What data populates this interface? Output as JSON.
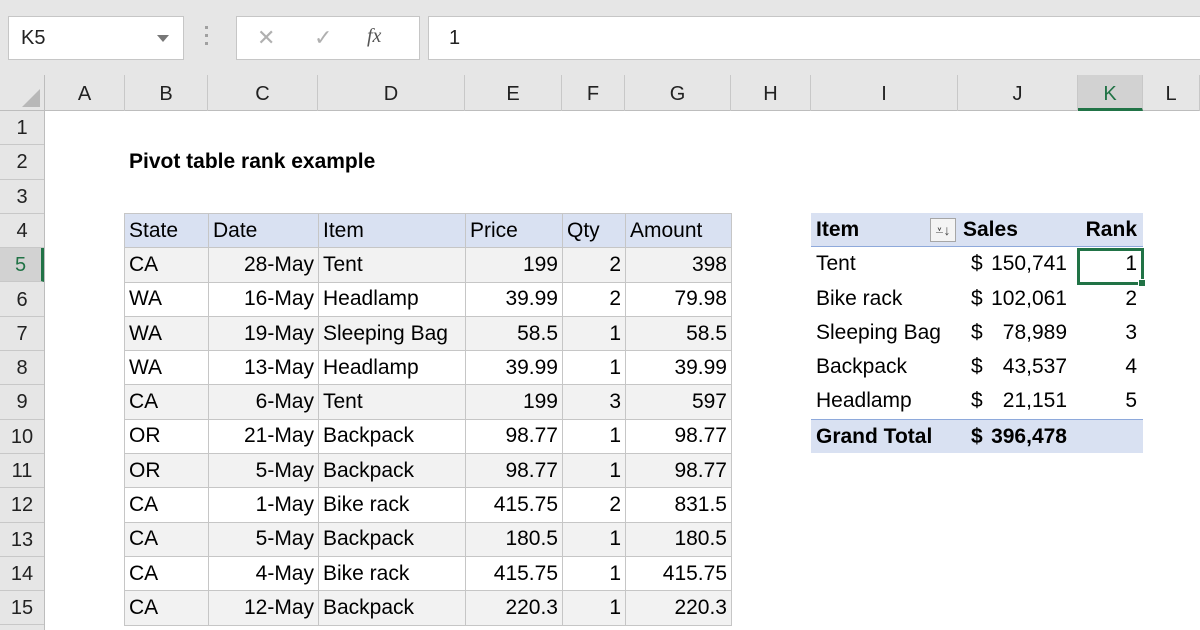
{
  "formula_bar": {
    "name_box": "K5",
    "cancel_icon": "✕",
    "enter_icon": "✓",
    "fx_label": "fx",
    "formula_value": "1"
  },
  "columns": [
    "A",
    "B",
    "C",
    "D",
    "E",
    "F",
    "G",
    "H",
    "I",
    "J",
    "K",
    "L"
  ],
  "selected_column": "K",
  "rows": [
    "1",
    "2",
    "3",
    "4",
    "5",
    "6",
    "7",
    "8",
    "9",
    "10",
    "11",
    "12",
    "13",
    "14",
    "15"
  ],
  "selected_row": "5",
  "sheet_title": "Pivot table rank example",
  "source_table": {
    "headers": [
      "State",
      "Date",
      "Item",
      "Price",
      "Qty",
      "Amount"
    ],
    "rows": [
      [
        "CA",
        "28-May",
        "Tent",
        "199",
        "2",
        "398"
      ],
      [
        "WA",
        "16-May",
        "Headlamp",
        "39.99",
        "2",
        "79.98"
      ],
      [
        "WA",
        "19-May",
        "Sleeping Bag",
        "58.5",
        "1",
        "58.5"
      ],
      [
        "WA",
        "13-May",
        "Headlamp",
        "39.99",
        "1",
        "39.99"
      ],
      [
        "CA",
        "6-May",
        "Tent",
        "199",
        "3",
        "597"
      ],
      [
        "OR",
        "21-May",
        "Backpack",
        "98.77",
        "1",
        "98.77"
      ],
      [
        "OR",
        "5-May",
        "Backpack",
        "98.77",
        "1",
        "98.77"
      ],
      [
        "CA",
        "1-May",
        "Bike rack",
        "415.75",
        "2",
        "831.5"
      ],
      [
        "CA",
        "5-May",
        "Backpack",
        "180.5",
        "1",
        "180.5"
      ],
      [
        "CA",
        "4-May",
        "Bike rack",
        "415.75",
        "1",
        "415.75"
      ],
      [
        "CA",
        "12-May",
        "Backpack",
        "220.3",
        "1",
        "220.3"
      ]
    ]
  },
  "pivot_table": {
    "headers": {
      "item": "Item",
      "sort_icon": "⩡↓",
      "sales": "Sales",
      "rank": "Rank"
    },
    "rows": [
      {
        "item": "Tent",
        "currency": "$",
        "sales": "150,741",
        "rank": "1"
      },
      {
        "item": "Bike rack",
        "currency": "$",
        "sales": "102,061",
        "rank": "2"
      },
      {
        "item": "Sleeping Bag",
        "currency": "$",
        "sales": "78,989",
        "rank": "3"
      },
      {
        "item": "Backpack",
        "currency": "$",
        "sales": "43,537",
        "rank": "4"
      },
      {
        "item": "Headlamp",
        "currency": "$",
        "sales": "21,151",
        "rank": "5"
      }
    ],
    "total": {
      "label": "Grand Total",
      "currency": "$",
      "sales": "396,478"
    }
  },
  "colors": {
    "accent": "#217346",
    "header_fill": "#d9e1f2",
    "band_fill": "#f2f2f2"
  }
}
